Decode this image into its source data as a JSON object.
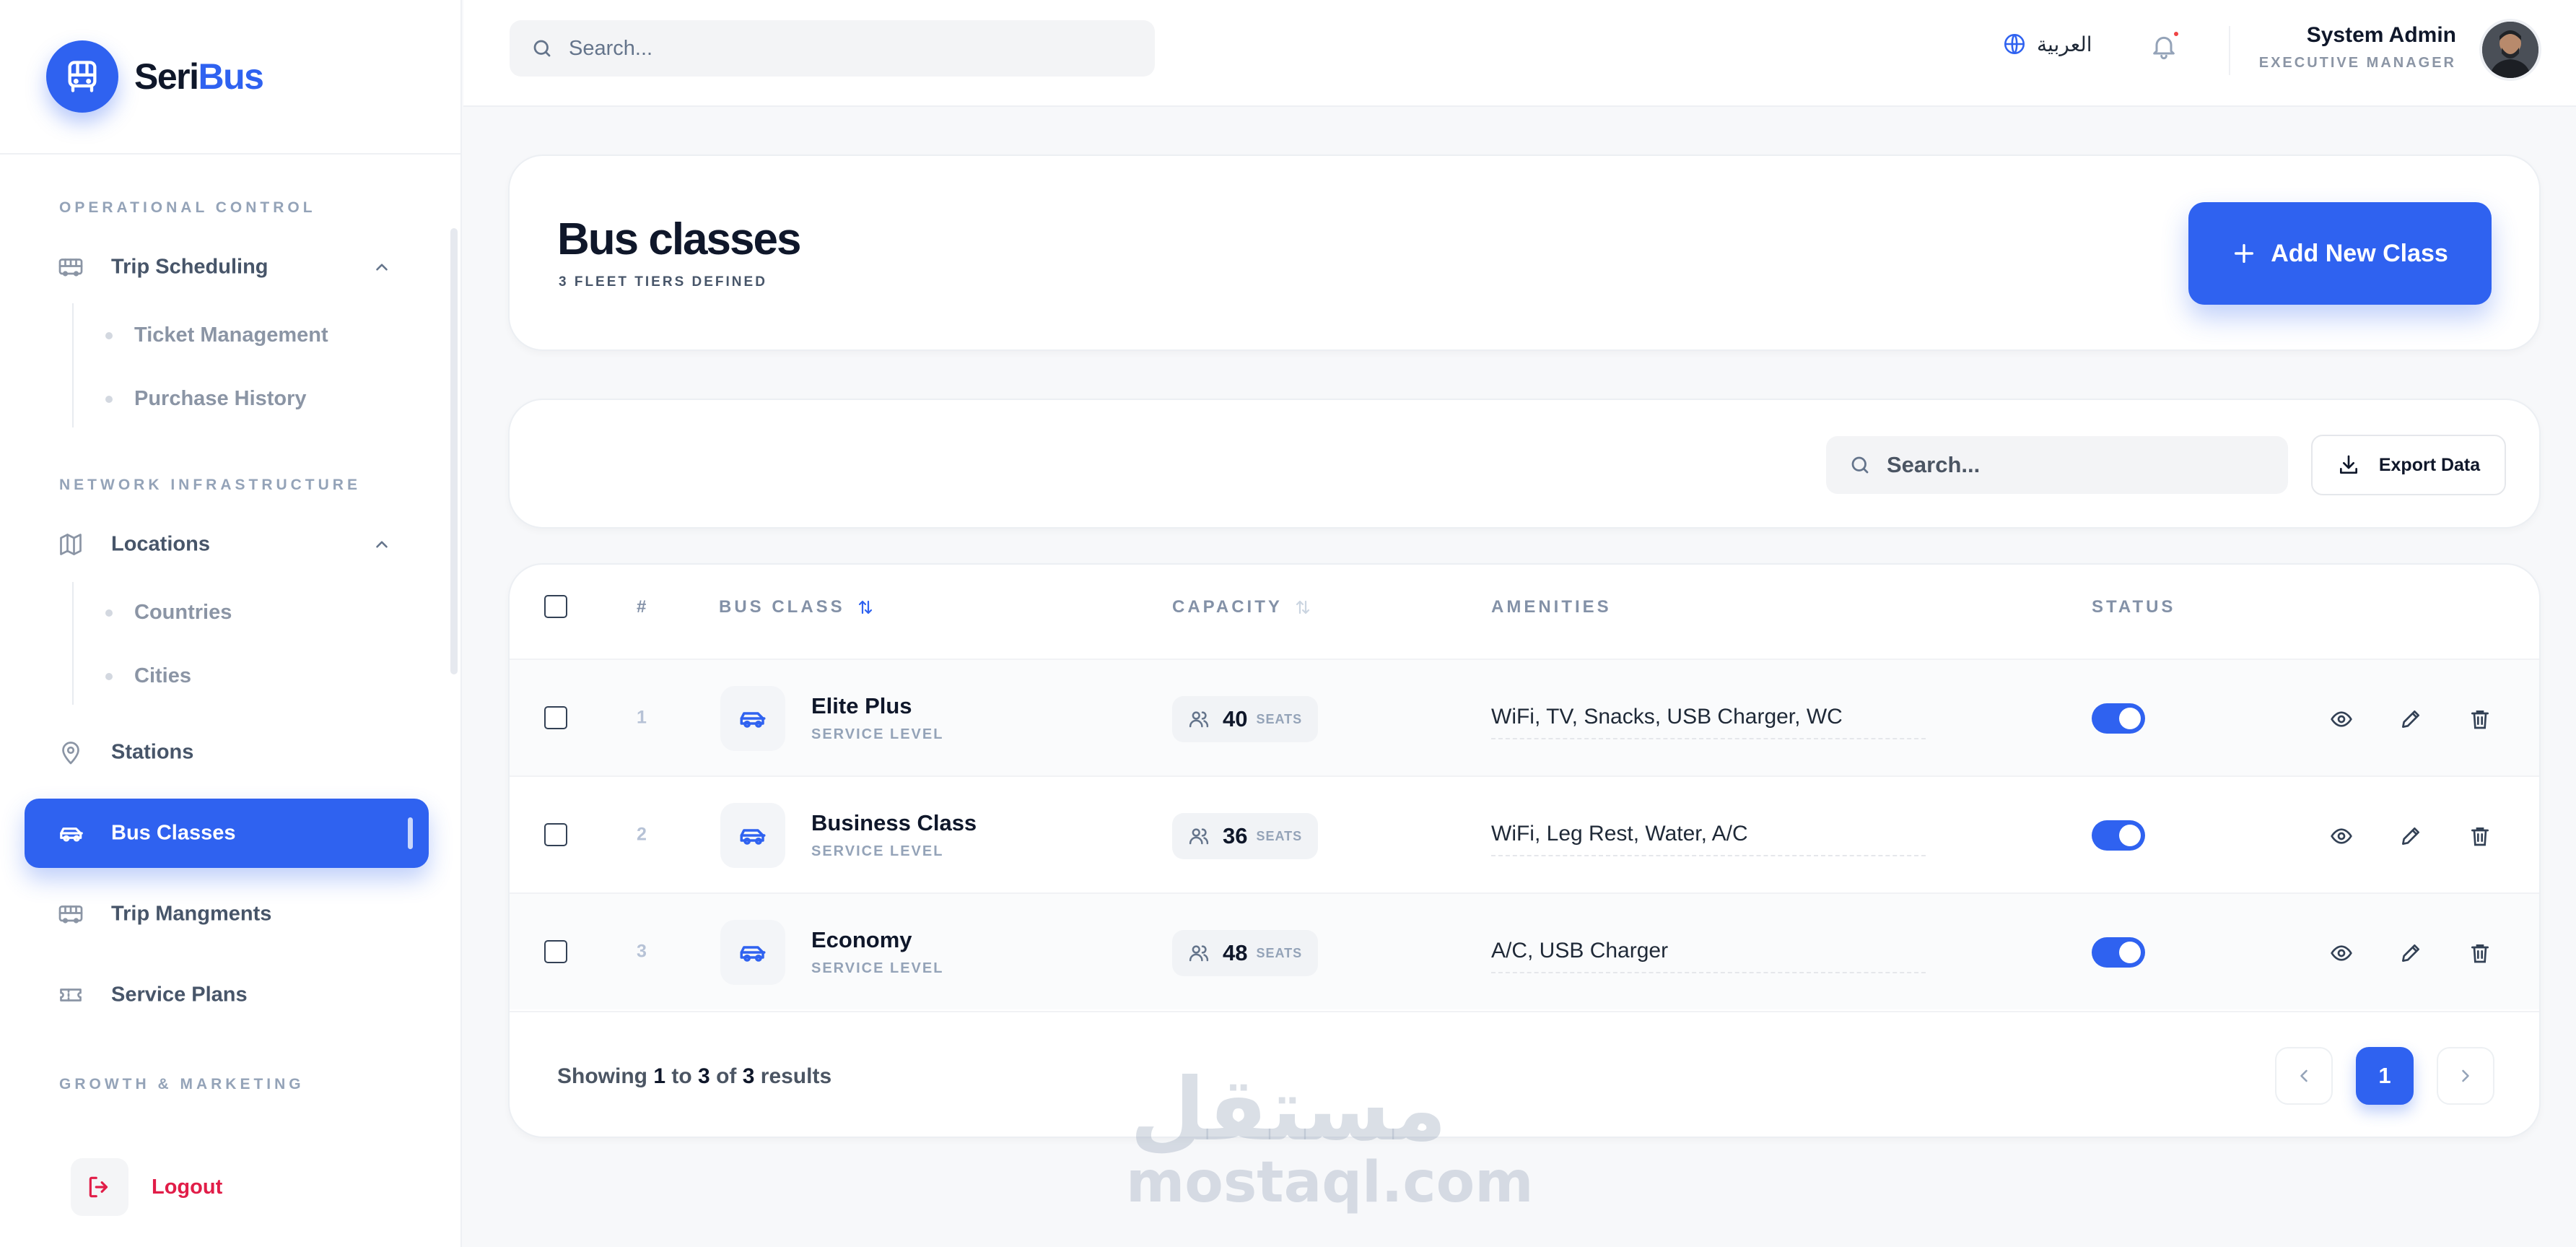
{
  "brand": {
    "name_part1": "Seri",
    "name_part2": "Bus"
  },
  "sidebar": {
    "sections": [
      {
        "label": "OPERATIONAL CONTROL"
      },
      {
        "label": "NETWORK INFRASTRUCTURE"
      },
      {
        "label": "GROWTH & MARKETING"
      }
    ],
    "items": {
      "trip_scheduling": "Trip Scheduling",
      "ticket_management": "Ticket Management",
      "purchase_history": "Purchase History",
      "locations": "Locations",
      "countries": "Countries",
      "cities": "Cities",
      "stations": "Stations",
      "bus_classes": "Bus Classes",
      "trip_mangments": "Trip Mangments",
      "service_plans": "Service Plans"
    },
    "active_item": "Bus Classes",
    "logout_label": "Logout"
  },
  "topbar": {
    "search_placeholder": "Search...",
    "language_label": "العربية",
    "user_name": "System Admin",
    "user_role": "EXECUTIVE MANAGER",
    "notifications_unread": true
  },
  "page": {
    "title": "Bus classes",
    "subtitle": "3 FLEET TIERS DEFINED",
    "add_button_label": "Add New Class"
  },
  "filters": {
    "search_placeholder": "Search...",
    "export_label": "Export Data"
  },
  "table": {
    "headers": {
      "number": "#",
      "bus_class": "BUS CLASS",
      "capacity": "CAPACITY",
      "amenities": "AMENITIES",
      "status": "STATUS"
    },
    "rows": [
      {
        "num": "1",
        "name": "Elite Plus",
        "level": "SERVICE LEVEL",
        "seats": "40",
        "seats_unit": "SEATS",
        "amenities": "WiFi, TV, Snacks, USB Charger, WC",
        "active": true
      },
      {
        "num": "2",
        "name": "Business Class",
        "level": "SERVICE LEVEL",
        "seats": "36",
        "seats_unit": "SEATS",
        "amenities": "WiFi, Leg Rest, Water, A/C",
        "active": true
      },
      {
        "num": "3",
        "name": "Economy",
        "level": "SERVICE LEVEL",
        "seats": "48",
        "seats_unit": "SEATS",
        "amenities": "A/C, USB Charger",
        "active": true
      }
    ]
  },
  "footer": {
    "showing_prefix": "Showing",
    "from": "1",
    "to_word": "to",
    "to": "3",
    "of_word": "of",
    "total": "3",
    "results_word": "results",
    "current_page": "1"
  },
  "watermark": {
    "arabic": "مستقل",
    "latin": "mostaql.com"
  },
  "colors": {
    "accent": "#2f62f0",
    "danger": "#e11d48",
    "muted": "#94a3b8"
  }
}
